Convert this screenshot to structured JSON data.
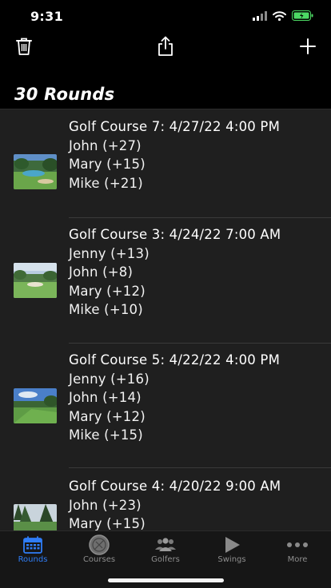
{
  "status": {
    "time": "9:31"
  },
  "header": {
    "title": "30 Rounds"
  },
  "rounds": [
    {
      "title": "Golf Course 7: 4/27/22 4:00 PM",
      "players": [
        "John (+27)",
        "Mary (+15)",
        "Mike (+21)"
      ]
    },
    {
      "title": "Golf Course 3: 4/24/22 7:00 AM",
      "players": [
        "Jenny (+13)",
        "John (+8)",
        "Mary (+12)",
        "Mike (+10)"
      ]
    },
    {
      "title": "Golf Course 5: 4/22/22 4:00 PM",
      "players": [
        "Jenny (+16)",
        "John (+14)",
        "Mary (+12)",
        "Mike (+15)"
      ]
    },
    {
      "title": "Golf Course 4: 4/20/22 9:00 AM",
      "players": [
        "John (+23)",
        "Mary (+15)"
      ]
    }
  ],
  "tabs": [
    {
      "label": "Rounds",
      "icon": "calendar-icon",
      "active": true
    },
    {
      "label": "Courses",
      "icon": "golf-ball-icon",
      "active": false
    },
    {
      "label": "Golfers",
      "icon": "people-icon",
      "active": false
    },
    {
      "label": "Swings",
      "icon": "play-icon",
      "active": false
    },
    {
      "label": "More",
      "icon": "more-icon",
      "active": false
    }
  ],
  "colors": {
    "accent": "#2f7df6",
    "background": "#000000",
    "list_background": "#1f1f1f",
    "battery": "#4cd964"
  }
}
